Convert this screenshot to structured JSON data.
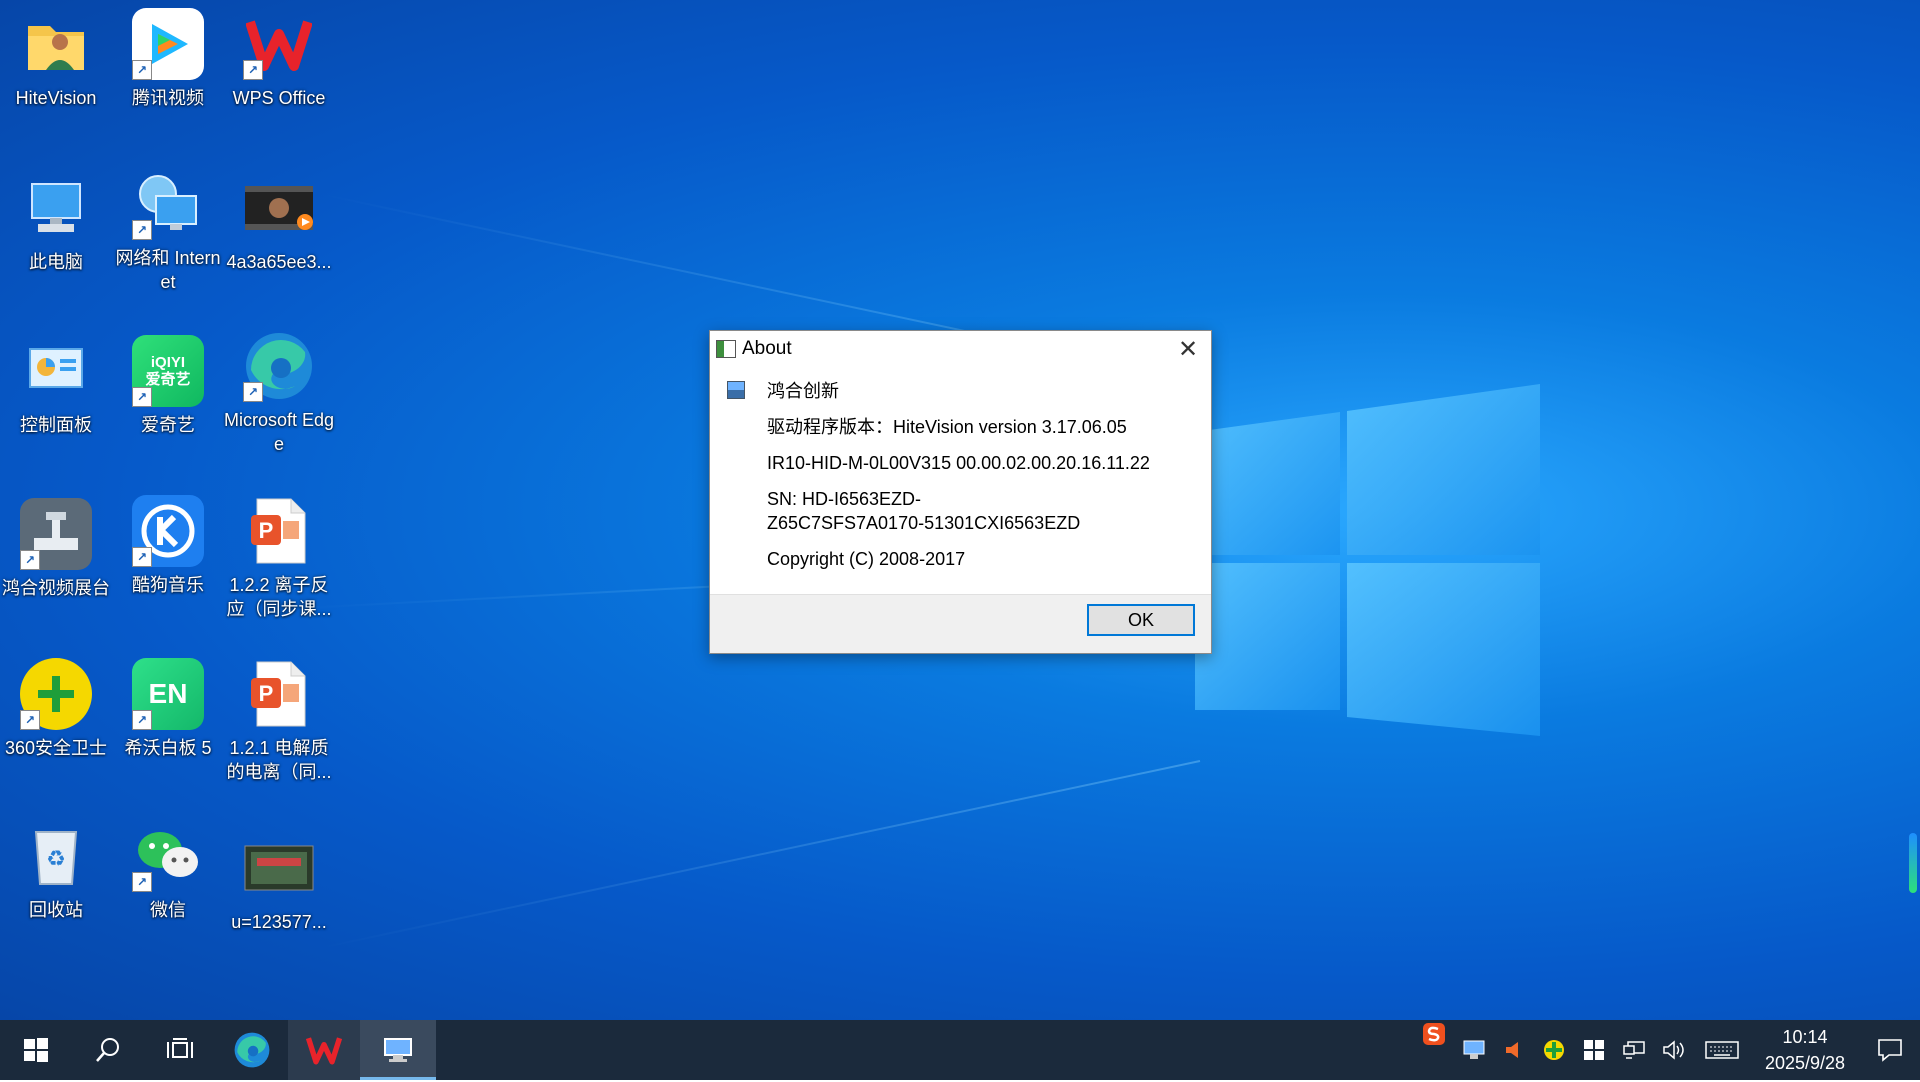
{
  "desktop": {
    "icons": [
      {
        "label": "HiteVision"
      },
      {
        "label": "腾讯视频"
      },
      {
        "label": "WPS Office"
      },
      {
        "label": "此电脑"
      },
      {
        "label": "网络和 Internet"
      },
      {
        "label": "4a3a65ee3..."
      },
      {
        "label": "控制面板"
      },
      {
        "label": "爱奇艺"
      },
      {
        "label": "Microsoft Edge"
      },
      {
        "label": "鸿合视频展台"
      },
      {
        "label": "酷狗音乐"
      },
      {
        "label": "1.2.2 离子反应（同步课..."
      },
      {
        "label": "360安全卫士"
      },
      {
        "label": "希沃白板 5"
      },
      {
        "label": "1.2.1 电解质的电离（同..."
      },
      {
        "label": "回收站"
      },
      {
        "label": "微信"
      },
      {
        "label": "u=123577..."
      }
    ],
    "iqiyi_logo_text": "iQIYI\n爱奇艺",
    "en_logo_text": "EN",
    "ppt_glyph": "P"
  },
  "dialog": {
    "title": "About",
    "close_glyph": "✕",
    "company": "鸿合创新",
    "driver_version": "驱动程序版本：HiteVision version 3.17.06.05",
    "firmware": "IR10-HID-M-0L00V315 00.00.02.00.20.16.11.22",
    "sn_line1": "SN: HD-I6563EZD-",
    "sn_line2": "Z65C7SFS7A0170-51301CXI6563EZD",
    "copyright": "Copyright (C) 2008-2017",
    "ok_label": "OK"
  },
  "taskbar": {
    "clock_time": "10:14",
    "clock_date": "2025/9/28"
  },
  "colors": {
    "taskbar": "#1b2a3c",
    "accent": "#0078d7"
  }
}
